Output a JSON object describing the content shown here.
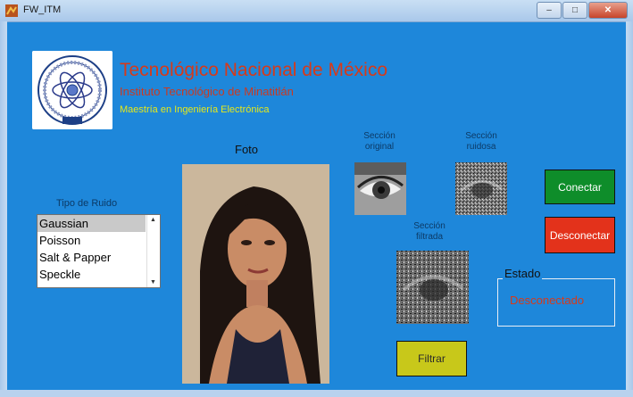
{
  "window": {
    "title": "FW_ITM"
  },
  "header": {
    "title": "Tecnológico Nacional de México",
    "institute": "Instituto Tecnológico de Minatitlán",
    "program": "Maestría en Ingeniería Electrónica"
  },
  "photo": {
    "label": "Foto"
  },
  "sections": {
    "original": "Sección\noriginal",
    "noisy": "Sección\nruidosa",
    "filtered": "Sección\nfiltrada"
  },
  "noise": {
    "label": "Tipo de Ruido",
    "options": [
      "Gaussian",
      "Poisson",
      "Salt & Papper",
      "Speckle"
    ],
    "selected": "Gaussian"
  },
  "buttons": {
    "connect": "Conectar",
    "disconnect": "Desconectar",
    "filter": "Filtrar"
  },
  "status": {
    "title": "Estado",
    "value": "Desconectado"
  },
  "colors": {
    "background": "#1e87da",
    "connect": "#0e8d2a",
    "disconnect": "#e3321b",
    "filter": "#c8c81a"
  }
}
